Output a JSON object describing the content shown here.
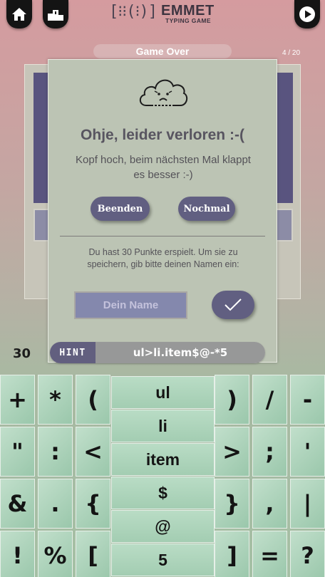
{
  "header": {
    "home_icon": "home-icon",
    "leaderboard_icon": "podium-icon",
    "play_icon": "play-icon",
    "logo_mark": "[⁝⁝(⁝)]",
    "logo_title": "EMMET",
    "logo_subtitle": "TYPING GAME",
    "status": "Game Over",
    "progress": "4 / 20"
  },
  "dialog": {
    "icon": "sad-cloud-icon",
    "title": "Ohje, leider verloren :-(",
    "subtitle": "Kopf hoch, beim nächsten Mal klappt es besser :-)",
    "quit_label": "Beenden",
    "retry_label": "Nochmal",
    "save_prompt": "Du hast 30 Punkte erspielt. Um sie zu speichern, gib bitte deinen Namen ein:",
    "name_placeholder": "Dein Name",
    "name_value": "",
    "submit_icon": "checkmark-icon"
  },
  "game": {
    "score": "30",
    "hint_label": "HINT",
    "hint_text": "ul>li.item$@-*5"
  },
  "keyboard": {
    "left_keys": [
      [
        "+",
        "*",
        "("
      ],
      [
        "\"",
        ":",
        "<"
      ],
      [
        "&",
        ".",
        "{"
      ],
      [
        "!",
        "%",
        "["
      ]
    ],
    "right_keys": [
      [
        ")",
        "/",
        "-"
      ],
      [
        ">",
        ";",
        "'"
      ],
      [
        "}",
        ",",
        "|"
      ],
      [
        "]",
        "=",
        "?"
      ]
    ],
    "snippets": [
      "ul",
      "li",
      "item",
      "$",
      "@",
      "5"
    ]
  },
  "colors": {
    "accent": "#615f81",
    "modal_bg": "#bcc4b4",
    "key_green": "#9ac7ab",
    "top_pink": "#d59b9f"
  }
}
